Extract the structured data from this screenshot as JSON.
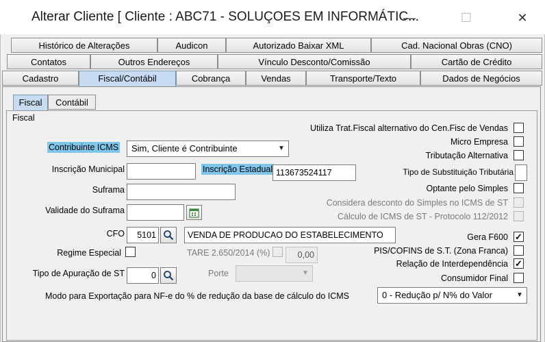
{
  "window": {
    "title": "Alterar Cliente [ Cliente : ABC71 - SOLUÇOES EM INFORMÁTIC...",
    "minimize": "—",
    "maximize": "☐",
    "close": "✕"
  },
  "tabs": {
    "row1": [
      "Histórico de Alterações",
      "Audicon",
      "Autorizado Baixar XML",
      "Cad. Nacional Obras (CNO)"
    ],
    "row2": [
      "Contatos",
      "Outros Endereços",
      "Vínculo Desconto/Comissão",
      "Cartão de Crédito"
    ],
    "row3": [
      "Cadastro",
      "Fiscal/Contábil",
      "Cobrança",
      "Vendas",
      "Transporte/Texto",
      "Dados de Negócios"
    ]
  },
  "subtabs": [
    "Fiscal",
    "Contábil"
  ],
  "group_title": "Fiscal",
  "form": {
    "contribuinte_label": "Contribuinte ICMS",
    "contribuinte_value": "Sim, Cliente é Contribuinte",
    "insc_municipal_label": "Inscrição Municipal",
    "insc_municipal_value": "",
    "insc_estadual_label": "Inscrição Estadual",
    "insc_estadual_value": "113673524117",
    "suframa_label": "Suframa",
    "suframa_value": "",
    "validade_suframa_label": "Validade do Suframa",
    "validade_suframa_value": "",
    "cfo_label": "CFO",
    "cfo_code": "5101",
    "cfo_desc": "VENDA DE PRODUCAO DO ESTABELECIMENTO",
    "regime_label": "Regime Especial",
    "tare_label": "TARE 2.650/2014 (%)",
    "tare_value": "0,00",
    "tipo_apuracao_label": "Tipo de Apuração de ST",
    "tipo_apuracao_value": "0",
    "porte_label": "Porte",
    "porte_value": "",
    "modo_label": "Modo para Exportação para NF-e do % de redução da base de cálculo do ICMS",
    "modo_value": "0 - Redução p/ N% do Valor"
  },
  "right_checks": {
    "utiliza": "Utiliza Trat.Fiscal alternativo do Cen.Fisc de Vendas",
    "micro": "Micro Empresa",
    "tributacao": "Tributação Alternativa",
    "tipo_subst": "Tipo de Substituição Tributária",
    "optante": "Optante pelo Simples",
    "considera": "Considera desconto do Simples no ICMS de ST",
    "calculo": "Cálculo de ICMS de ST - Protocolo 112/2012",
    "gera": "Gera F600",
    "pis": "PIS/COFINS de S.T. (Zona Franca)",
    "relacao": "Relação de Interdependência",
    "consumidor": "Consumidor Final"
  },
  "checked_mark": "✓",
  "colors": {
    "highlight": "#7ec6ec",
    "active_tab": "#c7dcf2"
  }
}
